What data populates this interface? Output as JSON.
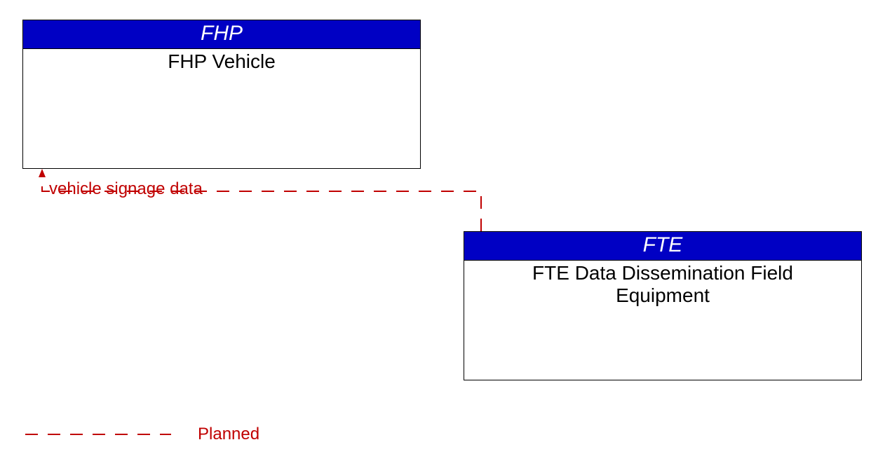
{
  "boxes": {
    "top": {
      "header": "FHP",
      "body": "FHP Vehicle"
    },
    "bottom": {
      "header": "FTE",
      "body_line1": "FTE Data Dissemination Field",
      "body_line2": "Equipment"
    }
  },
  "flow": {
    "label": "vehicle signage data"
  },
  "legend": {
    "label": "Planned"
  },
  "colors": {
    "header_bg": "#0000c4",
    "flow": "#c00000"
  }
}
